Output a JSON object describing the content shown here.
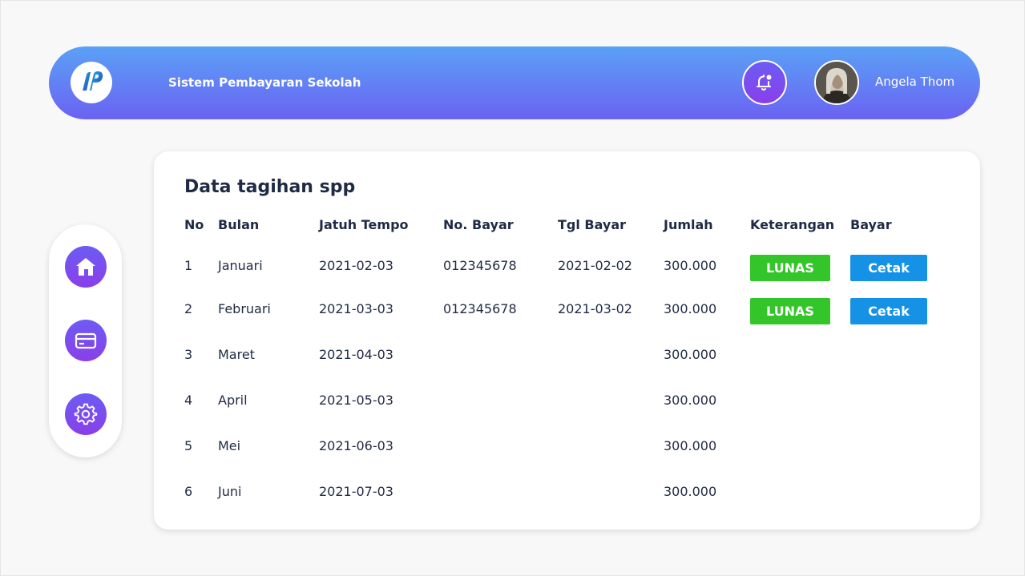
{
  "header": {
    "app_title": "Sistem Pembayaran Sekolah",
    "user_name": "Angela Thom"
  },
  "sidebar": {
    "items": [
      {
        "name": "home",
        "icon": "home-icon"
      },
      {
        "name": "payment",
        "icon": "card-icon"
      },
      {
        "name": "settings",
        "icon": "gear-icon"
      }
    ]
  },
  "table": {
    "title": "Data tagihan spp",
    "columns": [
      "No",
      "Bulan",
      "Jatuh Tempo",
      "No. Bayar",
      "Tgl Bayar",
      "Jumlah",
      "Keterangan",
      "Bayar"
    ],
    "rows": [
      {
        "no": "1",
        "bulan": "Januari",
        "jatuh_tempo": "2021-02-03",
        "no_bayar": "012345678",
        "tgl_bayar": "2021-02-02",
        "jumlah": "300.000",
        "keterangan": "LUNAS",
        "bayar": "Cetak"
      },
      {
        "no": "2",
        "bulan": "Februari",
        "jatuh_tempo": "2021-03-03",
        "no_bayar": "012345678",
        "tgl_bayar": "2021-03-02",
        "jumlah": "300.000",
        "keterangan": "LUNAS",
        "bayar": "Cetak"
      },
      {
        "no": "3",
        "bulan": "Maret",
        "jatuh_tempo": "2021-04-03",
        "no_bayar": "",
        "tgl_bayar": "",
        "jumlah": "300.000",
        "keterangan": "",
        "bayar": ""
      },
      {
        "no": "4",
        "bulan": "April",
        "jatuh_tempo": "2021-05-03",
        "no_bayar": "",
        "tgl_bayar": "",
        "jumlah": "300.000",
        "keterangan": "",
        "bayar": ""
      },
      {
        "no": "5",
        "bulan": "Mei",
        "jatuh_tempo": "2021-06-03",
        "no_bayar": "",
        "tgl_bayar": "",
        "jumlah": "300.000",
        "keterangan": "",
        "bayar": ""
      },
      {
        "no": "6",
        "bulan": "Juni",
        "jatuh_tempo": "2021-07-03",
        "no_bayar": "",
        "tgl_bayar": "",
        "jumlah": "300.000",
        "keterangan": "",
        "bayar": ""
      }
    ]
  },
  "colors": {
    "header_gradient_top": "#5aa1f6",
    "header_gradient_bottom": "#6b62f2",
    "accent_purple": "#7a4df0",
    "lunas_green": "#34c52a",
    "cetak_blue": "#1592e6"
  }
}
